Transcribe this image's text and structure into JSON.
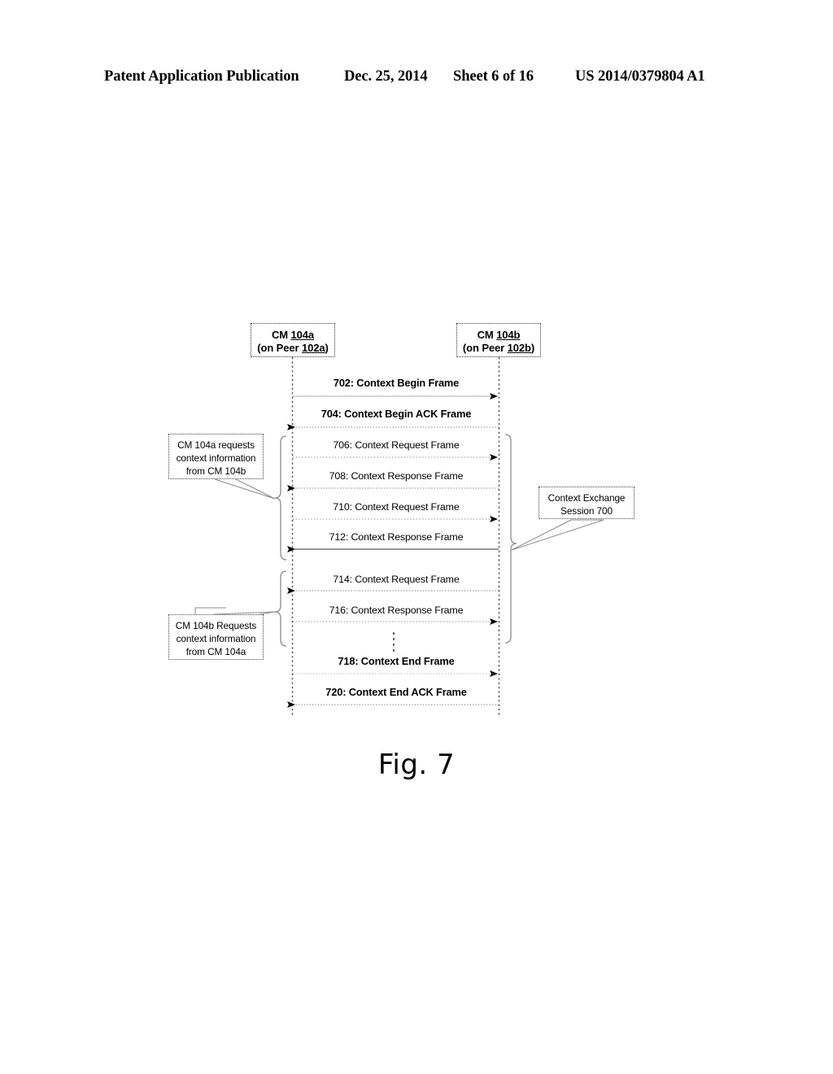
{
  "header": {
    "publication": "Patent Application Publication",
    "date": "Dec. 25, 2014",
    "sheet": "Sheet 6 of 16",
    "patent_number": "US 2014/0379804 A1"
  },
  "figure": {
    "caption": "Fig. 7",
    "lifelines": [
      {
        "id": "cm-104a",
        "line1_prefix": "CM ",
        "line1_ref": "104a",
        "line2_prefix": "(on Peer ",
        "line2_ref": "102a",
        "line2_suffix": ")"
      },
      {
        "id": "cm-104b",
        "line1_prefix": "CM ",
        "line1_ref": "104b",
        "line2_prefix": "(on Peer ",
        "line2_ref": "102b",
        "line2_suffix": ")"
      }
    ],
    "messages": [
      {
        "ref": "702",
        "label": "702: Context Begin Frame",
        "direction": "right",
        "bold": true,
        "line": "dotted"
      },
      {
        "ref": "704",
        "label": "704: Context Begin ACK Frame",
        "direction": "left",
        "bold": true,
        "line": "dotted"
      },
      {
        "ref": "706",
        "label": "706: Context Request Frame",
        "direction": "right",
        "bold": false,
        "line": "dotted"
      },
      {
        "ref": "708",
        "label": "708: Context Response Frame",
        "direction": "left",
        "bold": false,
        "line": "dotted"
      },
      {
        "ref": "710",
        "label": "710: Context Request Frame",
        "direction": "right",
        "bold": false,
        "line": "dotted"
      },
      {
        "ref": "712",
        "label": "712: Context Response Frame",
        "direction": "left",
        "bold": false,
        "line": "solid"
      },
      {
        "ref": "714",
        "label": "714: Context Request Frame",
        "direction": "left",
        "bold": false,
        "line": "dotted"
      },
      {
        "ref": "716",
        "label": "716: Context Response Frame",
        "direction": "right",
        "bold": false,
        "line": "dotted"
      },
      {
        "ref": "718",
        "label": "718: Context End Frame",
        "direction": "right",
        "bold": true,
        "line": "dotted"
      },
      {
        "ref": "720",
        "label": "720: Context End ACK Frame",
        "direction": "left",
        "bold": true,
        "line": "dotted"
      }
    ],
    "notes": [
      {
        "id": "note-a",
        "line1": "CM 104a requests",
        "line2": "context information",
        "line3": "from CM 104b"
      },
      {
        "id": "note-b",
        "line1": "CM 104b Requests",
        "line2": "context information",
        "line3": "from CM 104a"
      },
      {
        "id": "note-session",
        "line1": "Context Exchange",
        "line2": "Session 700",
        "line3": ""
      }
    ],
    "ellipsis": "⋮"
  }
}
